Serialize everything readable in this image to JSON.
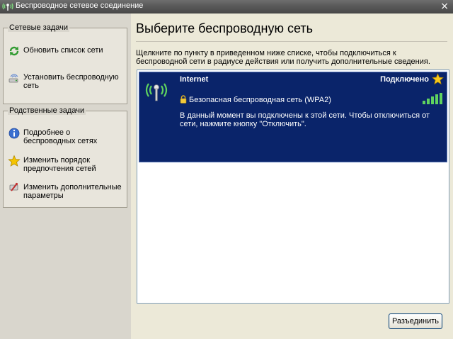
{
  "window": {
    "title": "Беспроводное сетевое соединение",
    "close_glyph": "×"
  },
  "sidebar": {
    "network_tasks": {
      "header": "Сетевые задачи",
      "items": [
        {
          "label": "Обновить список сети",
          "icon": "refresh-icon"
        },
        {
          "label": "Установить беспроводную сеть",
          "icon": "wireless-setup-icon"
        }
      ]
    },
    "related_tasks": {
      "header": "Родственные задачи",
      "items": [
        {
          "label": "Подробнее о беспроводных сетях",
          "icon": "info-icon"
        },
        {
          "label": "Изменить порядок предпочтения  сетей",
          "icon": "star-icon"
        },
        {
          "label": "Изменить дополнительные параметры",
          "icon": "settings-icon"
        }
      ]
    }
  },
  "main": {
    "heading": "Выберите беспроводную сеть",
    "intro": "Щелкните по пункту в приведенном ниже списке, чтобы подключиться к беспроводной сети в радиусе действия или получить дополнительные сведения.",
    "networks": [
      {
        "name": "Internet",
        "status": "Подключено",
        "security": "Безопасная беспроводная сеть (WPA2)",
        "description": "В данный момент вы подключены к этой сети. Чтобы отключиться от сети, нажмите кнопку \"Отключить\".",
        "signal_bars": 5
      }
    ],
    "disconnect_label": "Разъединить"
  },
  "colors": {
    "selection": "#0a246a",
    "signal": "#5fd35f",
    "titlebar": "#5a5a5a"
  }
}
